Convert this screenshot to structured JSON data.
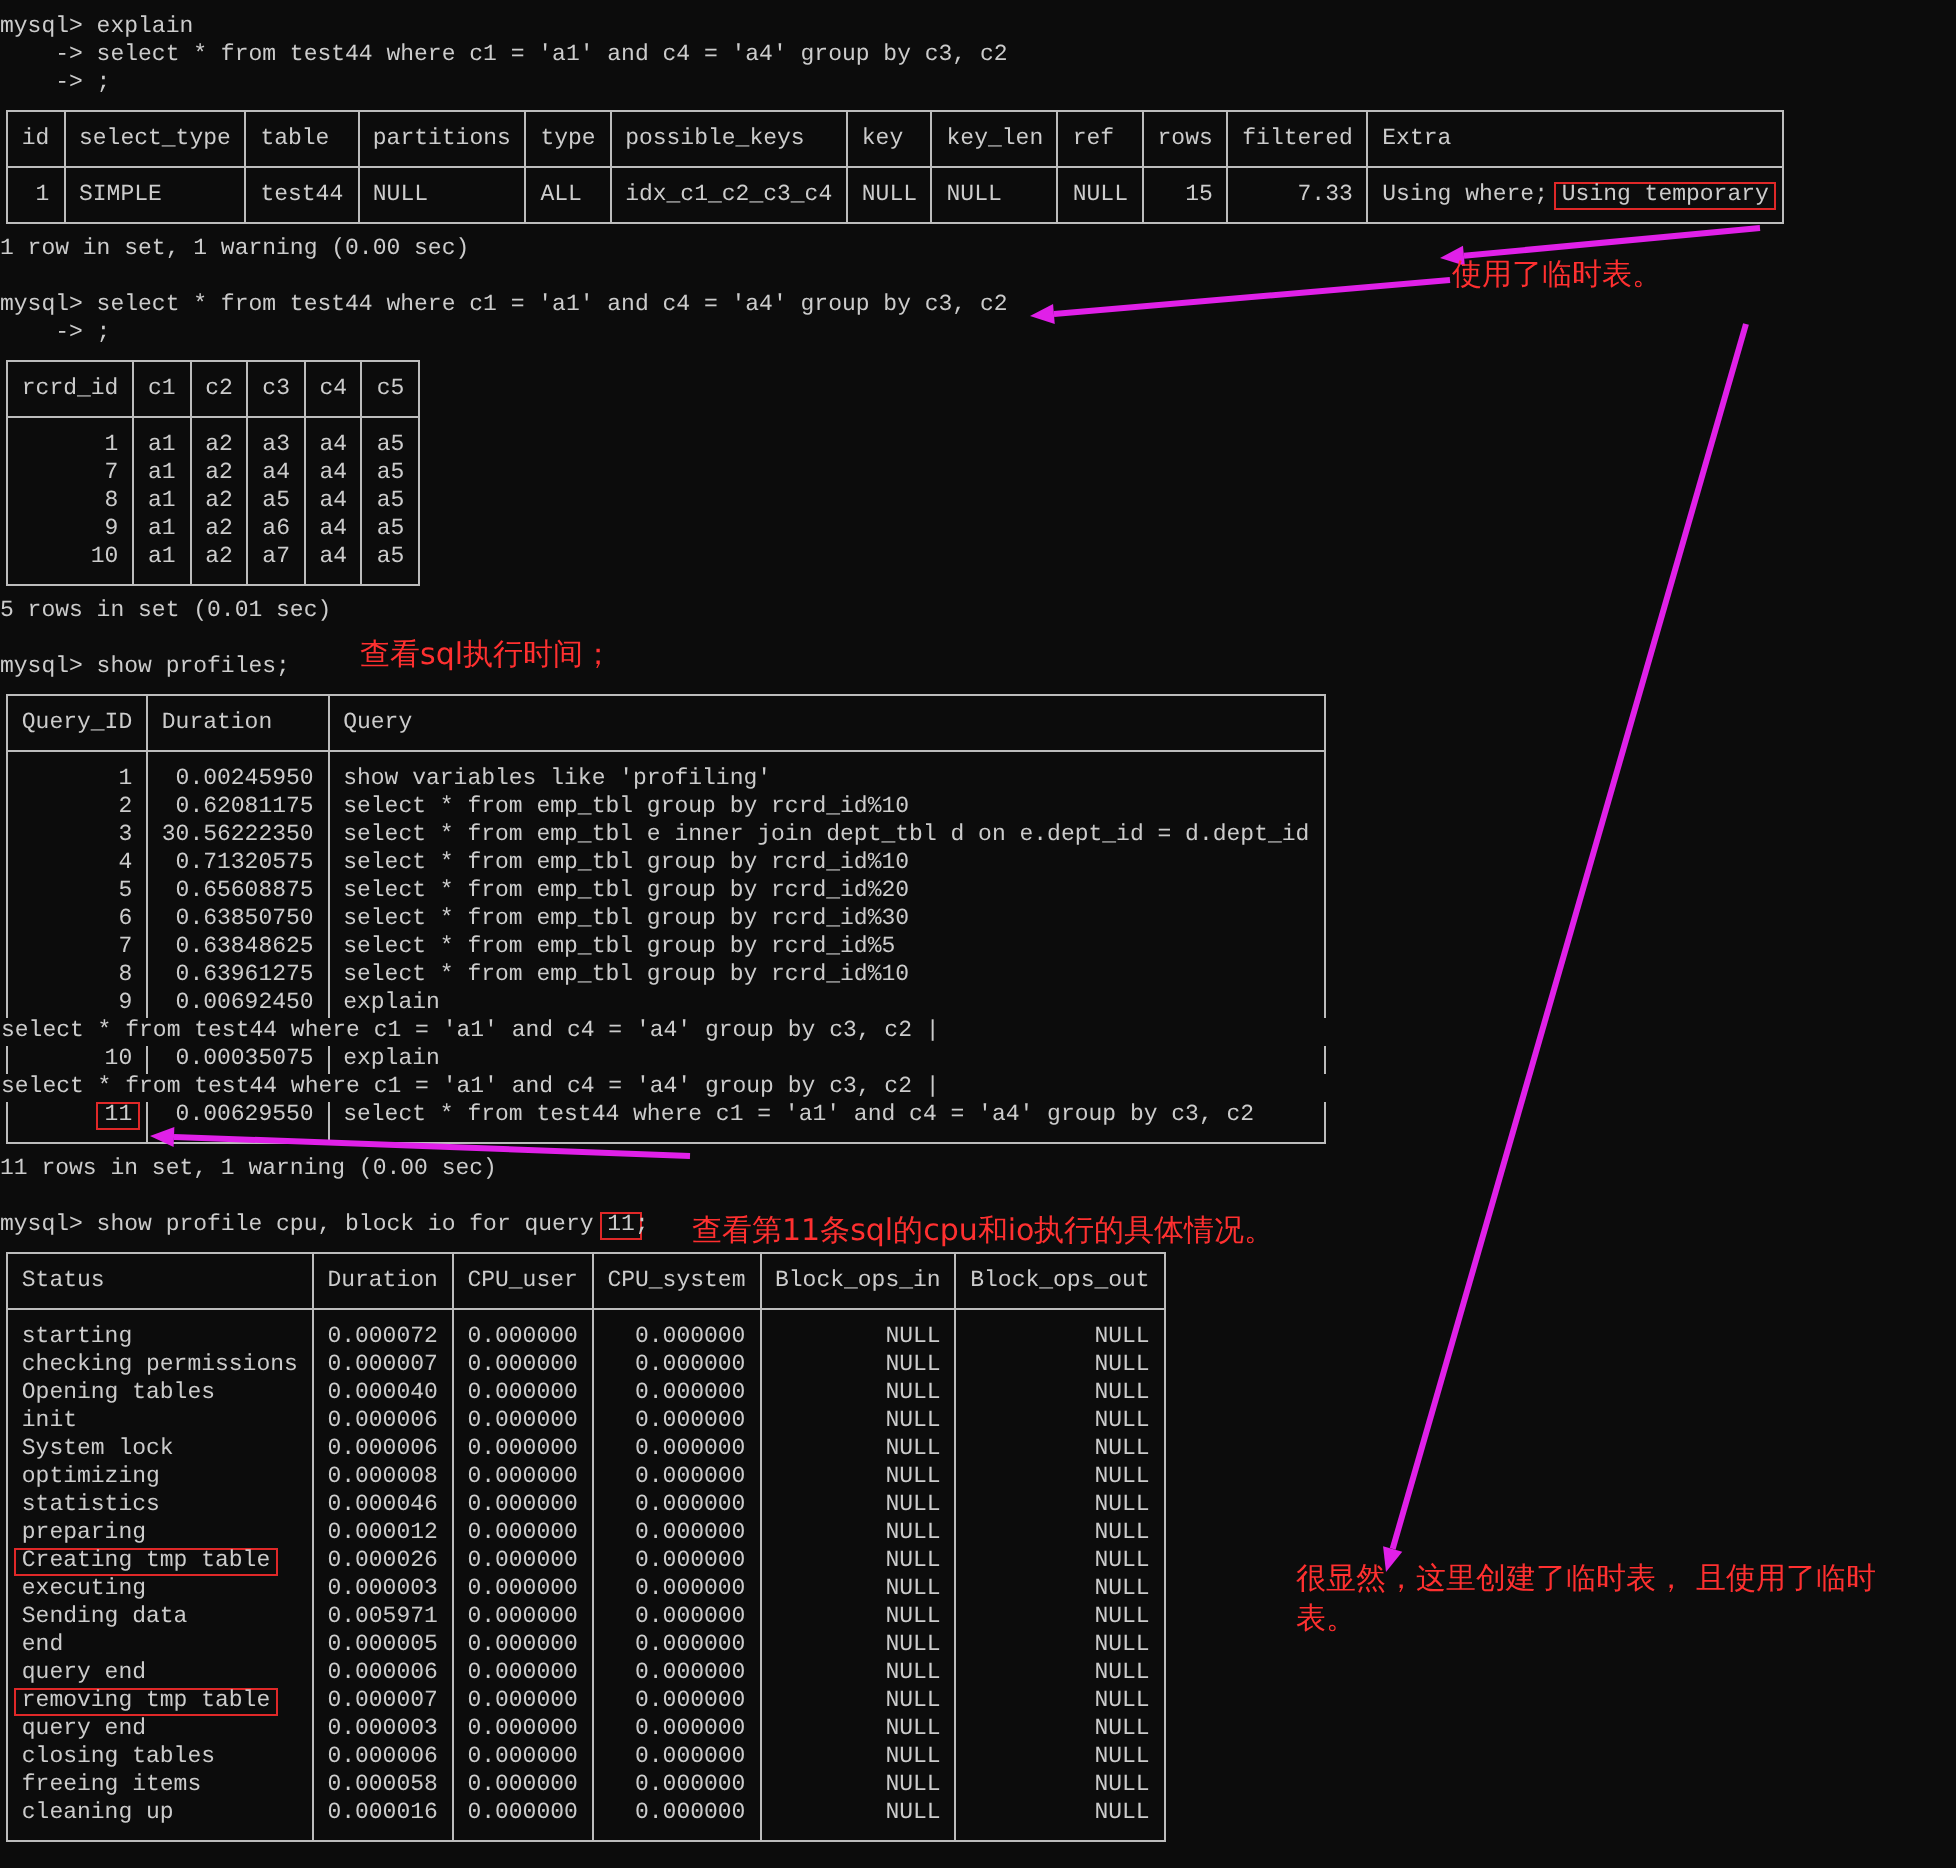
{
  "terminal": {
    "blocks": [
      {
        "kind": "line",
        "text": "mysql> explain"
      },
      {
        "kind": "line",
        "text": "    -> select * from test44 where c1 = 'a1' and c4 = 'a4' group by c3, c2"
      },
      {
        "kind": "line",
        "text": "    -> ;"
      },
      {
        "kind": "table",
        "columns": [
          {
            "label": "id",
            "right_aligned": true
          },
          {
            "label": "select_type"
          },
          {
            "label": "table"
          },
          {
            "label": "partitions"
          },
          {
            "label": "type"
          },
          {
            "label": "possible_keys"
          },
          {
            "label": "key"
          },
          {
            "label": "key_len"
          },
          {
            "label": "ref"
          },
          {
            "label": "rows",
            "right_aligned": true
          },
          {
            "label": "filtered",
            "right_aligned": true
          },
          {
            "label": "Extra"
          }
        ],
        "rows": [
          {
            "kind": "row",
            "cells": [
              "1",
              "SIMPLE",
              "test44",
              "NULL",
              "ALL",
              "idx_c1_c2_c3_c4",
              "NULL",
              "NULL",
              "NULL",
              "15",
              "7.33",
              [
                "Using where;",
                {
                  "text": "Using temporary",
                  "boxed": true
                }
              ]
            ]
          }
        ]
      },
      {
        "kind": "line",
        "text": "1 row in set, 1 warning (0.00 sec)"
      },
      {
        "kind": "blank"
      },
      {
        "kind": "line",
        "text": "mysql> select * from test44 where c1 = 'a1' and c4 = 'a4' group by c3, c2"
      },
      {
        "kind": "line",
        "text": "    -> ;"
      },
      {
        "kind": "table",
        "columns": [
          {
            "label": "rcrd_id",
            "right_aligned": true
          },
          {
            "label": "c1"
          },
          {
            "label": "c2"
          },
          {
            "label": "c3"
          },
          {
            "label": "c4"
          },
          {
            "label": "c5"
          }
        ],
        "rows": [
          {
            "kind": "row",
            "cells": [
              "1",
              "a1",
              "a2",
              "a3",
              "a4",
              "a5"
            ]
          },
          {
            "kind": "row",
            "cells": [
              "7",
              "a1",
              "a2",
              "a4",
              "a4",
              "a5"
            ]
          },
          {
            "kind": "row",
            "cells": [
              "8",
              "a1",
              "a2",
              "a5",
              "a4",
              "a5"
            ]
          },
          {
            "kind": "row",
            "cells": [
              "9",
              "a1",
              "a2",
              "a6",
              "a4",
              "a5"
            ]
          },
          {
            "kind": "row",
            "cells": [
              "10",
              "a1",
              "a2",
              "a7",
              "a4",
              "a5"
            ]
          }
        ]
      },
      {
        "kind": "line",
        "text": "5 rows in set (0.01 sec)"
      },
      {
        "kind": "blank"
      },
      {
        "kind": "line",
        "text": "mysql> show profiles;"
      },
      {
        "kind": "table",
        "columns": [
          {
            "label": "Query_ID",
            "right_aligned": true
          },
          {
            "label": "Duration",
            "right_aligned": true
          },
          {
            "label": "Query"
          }
        ],
        "rows": [
          {
            "kind": "row",
            "cells": [
              "1",
              "0.00245950",
              "show variables like 'profiling'"
            ]
          },
          {
            "kind": "row",
            "cells": [
              "2",
              "0.62081175",
              "select * from emp_tbl group by rcrd_id%10"
            ]
          },
          {
            "kind": "row",
            "cells": [
              "3",
              "30.56222350",
              "select * from emp_tbl e inner join dept_tbl d on e.dept_id = d.dept_id"
            ]
          },
          {
            "kind": "row",
            "cells": [
              "4",
              "0.71320575",
              "select * from emp_tbl group by rcrd_id%10"
            ]
          },
          {
            "kind": "row",
            "cells": [
              "5",
              "0.65608875",
              "select * from emp_tbl group by rcrd_id%20"
            ]
          },
          {
            "kind": "row",
            "cells": [
              "6",
              "0.63850750",
              "select * from emp_tbl group by rcrd_id%30"
            ]
          },
          {
            "kind": "row",
            "cells": [
              "7",
              "0.63848625",
              "select * from emp_tbl group by rcrd_id%5"
            ]
          },
          {
            "kind": "row",
            "cells": [
              "8",
              "0.63961275",
              "select * from emp_tbl group by rcrd_id%10"
            ]
          },
          {
            "kind": "row",
            "cells": [
              "9",
              "0.00692450",
              "explain"
            ]
          },
          {
            "kind": "wrap",
            "text": "select * from test44 where c1 = 'a1' and c4 = 'a4' group by c3, c2 |"
          },
          {
            "kind": "row",
            "cells": [
              "10",
              "0.00035075",
              "explain"
            ]
          },
          {
            "kind": "wrap",
            "text": "select * from test44 where c1 = 'a1' and c4 = 'a4' group by c3, c2 |"
          },
          {
            "kind": "row",
            "cells": [
              {
                "text": "11",
                "boxed": true
              },
              "0.00629550",
              "select * from test44 where c1 = 'a1' and c4 = 'a4' group by c3, c2"
            ]
          }
        ]
      },
      {
        "kind": "line",
        "text": "11 rows in set, 1 warning (0.00 sec)"
      },
      {
        "kind": "blank"
      },
      {
        "kind": "line",
        "parts": [
          "mysql> show profile cpu, block io for query ",
          {
            "text": "11",
            "boxed": true
          },
          ";"
        ]
      },
      {
        "kind": "table",
        "columns": [
          {
            "label": "Status"
          },
          {
            "label": "Duration"
          },
          {
            "label": "CPU_user"
          },
          {
            "label": "CPU_system",
            "right_aligned": true
          },
          {
            "label": "Block_ops_in",
            "right_aligned": true
          },
          {
            "label": "Block_ops_out",
            "right_aligned": true
          }
        ],
        "rows": [
          {
            "kind": "row",
            "cells": [
              "starting",
              "0.000072",
              "0.000000",
              "0.000000",
              "NULL",
              "NULL"
            ]
          },
          {
            "kind": "row",
            "cells": [
              "checking permissions",
              "0.000007",
              "0.000000",
              "0.000000",
              "NULL",
              "NULL"
            ]
          },
          {
            "kind": "row",
            "cells": [
              "Opening tables",
              "0.000040",
              "0.000000",
              "0.000000",
              "NULL",
              "NULL"
            ]
          },
          {
            "kind": "row",
            "cells": [
              "init",
              "0.000006",
              "0.000000",
              "0.000000",
              "NULL",
              "NULL"
            ]
          },
          {
            "kind": "row",
            "cells": [
              "System lock",
              "0.000006",
              "0.000000",
              "0.000000",
              "NULL",
              "NULL"
            ]
          },
          {
            "kind": "row",
            "cells": [
              "optimizing",
              "0.000008",
              "0.000000",
              "0.000000",
              "NULL",
              "NULL"
            ]
          },
          {
            "kind": "row",
            "cells": [
              "statistics",
              "0.000046",
              "0.000000",
              "0.000000",
              "NULL",
              "NULL"
            ]
          },
          {
            "kind": "row",
            "cells": [
              "preparing",
              "0.000012",
              "0.000000",
              "0.000000",
              "NULL",
              "NULL"
            ]
          },
          {
            "kind": "row",
            "cells": [
              {
                "text": "Creating tmp table",
                "boxed": true
              },
              "0.000026",
              "0.000000",
              "0.000000",
              "NULL",
              "NULL"
            ]
          },
          {
            "kind": "row",
            "cells": [
              "executing",
              "0.000003",
              "0.000000",
              "0.000000",
              "NULL",
              "NULL"
            ]
          },
          {
            "kind": "row",
            "cells": [
              "Sending data",
              "0.005971",
              "0.000000",
              "0.000000",
              "NULL",
              "NULL"
            ]
          },
          {
            "kind": "row",
            "cells": [
              "end",
              "0.000005",
              "0.000000",
              "0.000000",
              "NULL",
              "NULL"
            ]
          },
          {
            "kind": "row",
            "cells": [
              "query end",
              "0.000006",
              "0.000000",
              "0.000000",
              "NULL",
              "NULL"
            ]
          },
          {
            "kind": "row",
            "cells": [
              {
                "text": "removing tmp table",
                "boxed": true
              },
              "0.000007",
              "0.000000",
              "0.000000",
              "NULL",
              "NULL"
            ]
          },
          {
            "kind": "row",
            "cells": [
              "query end",
              "0.000003",
              "0.000000",
              "0.000000",
              "NULL",
              "NULL"
            ]
          },
          {
            "kind": "row",
            "cells": [
              "closing tables",
              "0.000006",
              "0.000000",
              "0.000000",
              "NULL",
              "NULL"
            ]
          },
          {
            "kind": "row",
            "cells": [
              "freeing items",
              "0.000058",
              "0.000000",
              "0.000000",
              "NULL",
              "NULL"
            ]
          },
          {
            "kind": "row",
            "cells": [
              "cleaning up",
              "0.000016",
              "0.000000",
              "0.000000",
              "NULL",
              "NULL"
            ]
          }
        ]
      }
    ]
  },
  "annotations": [
    {
      "text": "使用了临时表。"
    },
    {
      "text": "查看sql执行时间；"
    },
    {
      "text": "查看第11条sql的cpu和io执行的具体情况。"
    },
    {
      "text": "很显然，这里创建了临时表， 且使用了临时表。"
    }
  ]
}
